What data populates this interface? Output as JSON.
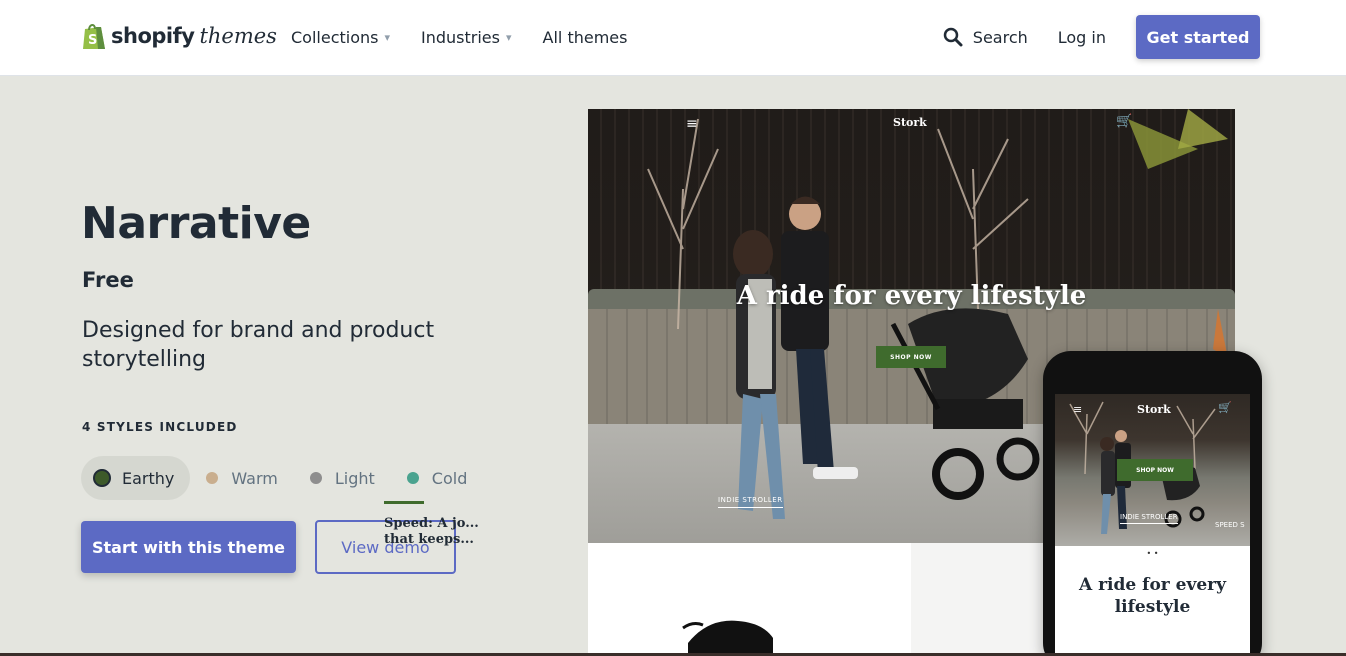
{
  "header": {
    "logo_brand": "shopify",
    "logo_sub": "themes",
    "nav": [
      {
        "label": "Collections",
        "has_dropdown": true
      },
      {
        "label": "Industries",
        "has_dropdown": true
      },
      {
        "label": "All themes",
        "has_dropdown": false
      }
    ],
    "search_label": "Search",
    "login_label": "Log in",
    "cta_label": "Get started"
  },
  "theme": {
    "name": "Narrative",
    "price": "Free",
    "description": "Designed for brand and product storytelling",
    "styles_label": "4 STYLES INCLUDED",
    "styles": [
      {
        "label": "Earthy",
        "color": "#3d5a2a",
        "selected": true
      },
      {
        "label": "Warm",
        "color": "#c9ae8e",
        "selected": false
      },
      {
        "label": "Light",
        "color": "#8e8e8e",
        "selected": false
      },
      {
        "label": "Cold",
        "color": "#4aa38f",
        "selected": false
      }
    ],
    "primary_button": "Start with this theme",
    "secondary_button": "View demo"
  },
  "preview": {
    "desktop": {
      "menu_icon": "≡",
      "logo": "Stork",
      "cart_icon": "🛒",
      "headline": "A ride for every lifestyle",
      "cta": "SHOP NOW",
      "caption": "INDIE STROLLER",
      "feature_title": "Speed: A jo... that keeps..."
    },
    "mobile": {
      "menu_icon": "≡",
      "logo": "Stork",
      "cart_icon": "🛒",
      "cta": "SHOP NOW",
      "caption": "INDIE STROLLER",
      "caption2": "SPEED S",
      "dots": "• •",
      "headline": "A ride for every lifestyle"
    }
  },
  "colors": {
    "accent": "#5c6ac4",
    "hero_bg": "#e4e5df",
    "text": "#212b36",
    "preview_green": "#3f6b2d"
  }
}
